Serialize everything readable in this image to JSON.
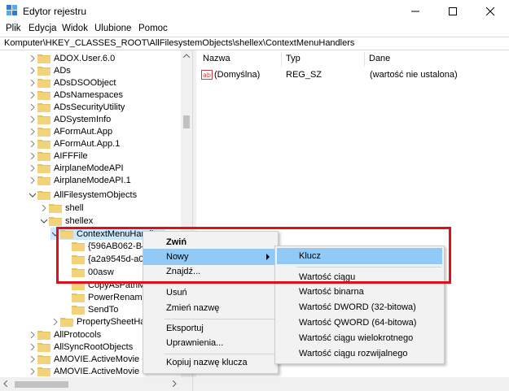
{
  "window": {
    "title": "Edytor rejestru",
    "icon": "regedit-icon"
  },
  "menubar": [
    "Plik",
    "Edycja",
    "Widok",
    "Ulubione",
    "Pomoc"
  ],
  "address": "Komputer\\HKEY_CLASSES_ROOT\\AllFilesystemObjects\\shellex\\ContextMenuHandlers",
  "tree": {
    "items": [
      {
        "label": "ADOX.User.6.0"
      },
      {
        "label": "ADs"
      },
      {
        "label": "ADsDSOObject"
      },
      {
        "label": "ADsNamespaces"
      },
      {
        "label": "ADsSecurityUtility"
      },
      {
        "label": "ADSystemInfo"
      },
      {
        "label": "AFormAut.App"
      },
      {
        "label": "AFormAut.App.1"
      },
      {
        "label": "AIFFFile"
      },
      {
        "label": "AirplaneModeAPI"
      },
      {
        "label": "AirplaneModeAPI.1"
      },
      {
        "label": "AllFilesystemObjects"
      },
      {
        "label": "shell"
      },
      {
        "label": "shellex"
      },
      {
        "label": "ContextMenuHandlers"
      },
      {
        "label": "{596AB062-B4D2-4215-9F74-E9109B0A8153}"
      },
      {
        "label": "{a2a9545d-a0c2-42b4-9708-a0b2badd77c8}"
      },
      {
        "label": "00asw"
      },
      {
        "label": "CopyAsPathMenu"
      },
      {
        "label": "PowerRenameExt"
      },
      {
        "label": "SendTo"
      },
      {
        "label": "PropertySheetHandlers"
      },
      {
        "label": "AllProtocols"
      },
      {
        "label": "AllSyncRootObjects"
      },
      {
        "label": "AMOVIE.ActiveMovie Control"
      },
      {
        "label": "AMOVIE.ActiveMovie Control.2"
      }
    ]
  },
  "list": {
    "columns": [
      "Nazwa",
      "Typ",
      "Dane"
    ],
    "rows": [
      {
        "name": "(Domyślna)",
        "type": "REG_SZ",
        "data": "(wartość nie ustalona)"
      }
    ]
  },
  "context_menu": {
    "items": [
      "Zwiń",
      "Nowy",
      "Znajdź...",
      "Usuń",
      "Zmień nazwę",
      "Eksportuj",
      "Uprawnienia...",
      "Kopiuj nazwę klucza"
    ]
  },
  "submenu": {
    "items": [
      "Klucz",
      "Wartość ciągu",
      "Wartość binarna",
      "Wartość DWORD (32-bitowa)",
      "Wartość QWORD (64-bitowa)",
      "Wartość ciągu wielokrotnego",
      "Wartość ciągu rozwijalnego"
    ]
  },
  "colors": {
    "highlight": "#91c9f7",
    "annotation": "#e0101a",
    "folder": "#e8c25a"
  }
}
